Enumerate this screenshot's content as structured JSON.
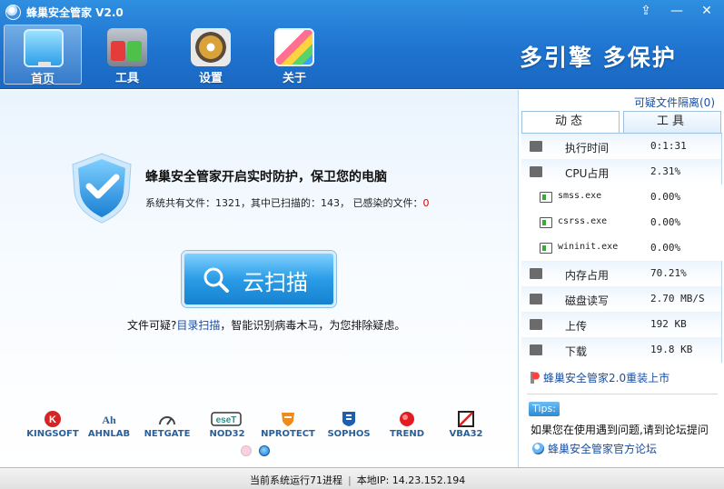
{
  "app": {
    "title": "蜂巢安全管家 V2.0"
  },
  "nav": [
    {
      "label": "首页",
      "icon": "monitor-icon",
      "active": true
    },
    {
      "label": "工具",
      "icon": "toolbox-icon",
      "active": false
    },
    {
      "label": "设置",
      "icon": "gear-icon",
      "active": false
    },
    {
      "label": "关于",
      "icon": "about-icon",
      "active": false
    }
  ],
  "slogan": "多引擎 多保护",
  "main": {
    "protect_title": "蜂巢安全管家开启实时防护，保卫您的电脑",
    "stats_prefix": "系统共有文件：",
    "total_files": "1321",
    "scanned_prefix": "，其中已扫描的：",
    "scanned_files": "143",
    "infected_prefix": "， 已感染的文件：",
    "infected_files": "0",
    "scan_button": "云扫描",
    "hint_prefix": "文件可疑?",
    "hint_link": "目录扫描",
    "hint_suffix": "，智能识别病毒木马，为您排除疑虑。",
    "engines": [
      "KINGSOFT",
      "AHNLAB",
      "NETGATE",
      "NOD32",
      "NPROTECT",
      "SOPHOS",
      "TREND",
      "VBA32"
    ]
  },
  "side": {
    "quarantine_link": "可疑文件隔离(0)",
    "tabs": [
      "动态",
      "工具"
    ],
    "rows": [
      {
        "label": "执行时间",
        "value": "0:1:31",
        "type": "main"
      },
      {
        "label": "CPU占用",
        "value": "2.31%",
        "type": "main"
      },
      {
        "label": "smss.exe",
        "value": "0.00%",
        "type": "sub"
      },
      {
        "label": "csrss.exe",
        "value": "0.00%",
        "type": "sub"
      },
      {
        "label": "wininit.exe",
        "value": "0.00%",
        "type": "sub"
      },
      {
        "label": "内存占用",
        "value": "70.21%",
        "type": "main"
      },
      {
        "label": "磁盘读写",
        "value": "2.70 MB/S",
        "type": "main"
      },
      {
        "label": "上传",
        "value": "192 KB",
        "type": "main"
      },
      {
        "label": "下载",
        "value": "19.8 KB",
        "type": "main"
      }
    ],
    "news": "蜂巢安全管家2.0重装上市",
    "tips_badge": "Tips:",
    "tips_text": "如果您在使用遇到问题,请到论坛提问",
    "forum_link": "蜂巢安全管家官方论坛"
  },
  "status": {
    "processes": "当前系统运行71进程",
    "separator": "|",
    "ip": "本地IP: 14.23.152.194"
  }
}
